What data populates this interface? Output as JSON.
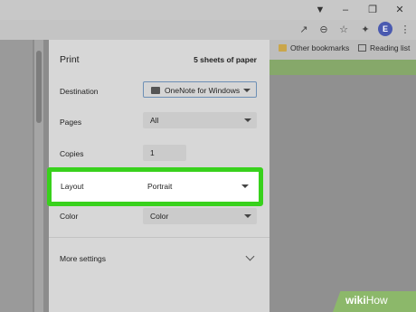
{
  "print": {
    "title": "Print",
    "sheets": "5 sheets of paper",
    "destination": {
      "label": "Destination",
      "value": "OneNote for Windows"
    },
    "pages": {
      "label": "Pages",
      "value": "All"
    },
    "copies": {
      "label": "Copies",
      "value": "1"
    },
    "layout": {
      "label": "Layout",
      "value": "Portrait"
    },
    "color": {
      "label": "Color",
      "value": "Color"
    },
    "more_settings": "More settings"
  },
  "bookmarks": [
    "Other bookmarks",
    "Reading list"
  ],
  "profile_initial": "E",
  "watermark": {
    "part1": "wiki",
    "part2": "How"
  },
  "colors": {
    "highlight": "#38d11c",
    "profile": "#4a5ab0",
    "watermark": "#8cb86a"
  }
}
